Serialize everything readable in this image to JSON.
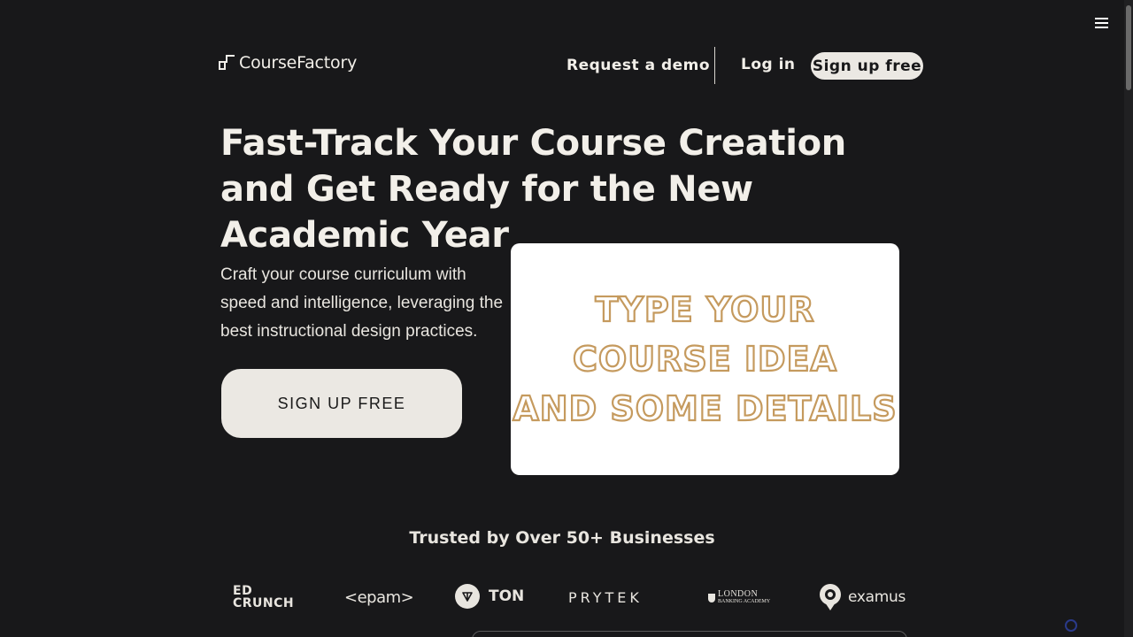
{
  "brand": {
    "name": "CourseFactory"
  },
  "nav": {
    "request_demo": "Request a demo",
    "log_in": "Log in",
    "sign_up": "Sign up free"
  },
  "hero": {
    "title": "Fast-Track Your Course Creation and Get Ready for the New Academic Year",
    "description": "Craft your course curriculum with speed and intelligence, leveraging the best instructional design practices.",
    "cta": "SIGN UP FREE"
  },
  "demo_card": {
    "lines": [
      "TYPE YOUR",
      "COURSE IDEA",
      "AND SOME DETAILS"
    ],
    "stroke_color": "#c59a5e"
  },
  "trusted": {
    "heading": "Trusted by Over 50+ Businesses",
    "logos": {
      "edcrunch_line1": "ED",
      "edcrunch_line2": "CRUNCH",
      "epam": "<epam>",
      "ton": "TON",
      "prytek": "PRYTEK",
      "london_line1": "LONDON",
      "london_line2": "BANKING ACADEMY",
      "examus": "examus"
    }
  },
  "colors": {
    "background": "#18181a",
    "text": "#f2efe9",
    "button_bg": "#ebe8e3",
    "accent_gold": "#c59a5e"
  },
  "icons": {
    "menu": "hamburger-menu-icon",
    "ton": "ton-logo-icon",
    "examus": "examus-logo-icon"
  }
}
